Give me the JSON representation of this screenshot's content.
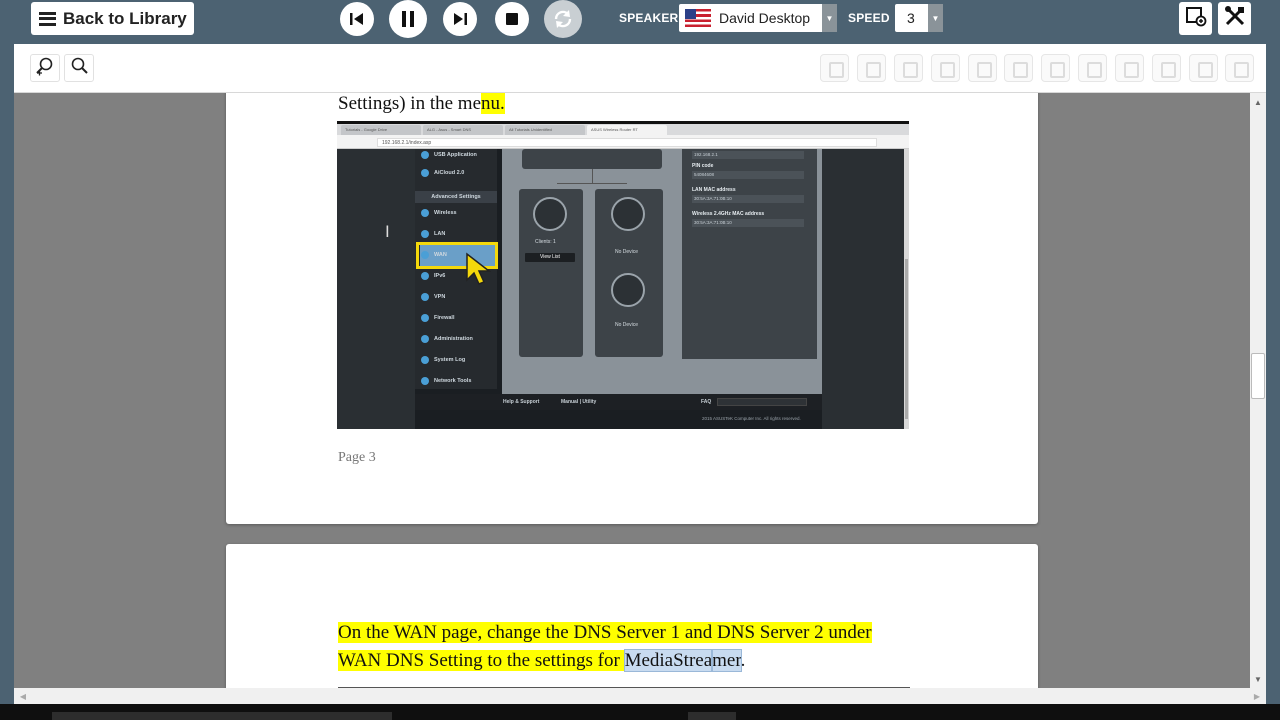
{
  "toolbar": {
    "back_label": "Back to Library",
    "speaker_label": "SPEAKER",
    "speaker_value": "David Desktop",
    "speed_label": "SPEED",
    "speed_value": "3"
  },
  "colors": {
    "toolbar_bg": "#4c6272",
    "highlight": "#ffff00",
    "selection": "#c8dbf0",
    "viewport_bg": "#808080"
  },
  "icons": {
    "back": "list-icon",
    "prev": "skip-back-icon",
    "pause": "pause-icon",
    "next": "skip-forward-icon",
    "stop": "stop-icon",
    "repeat": "repeat-icon",
    "right_tool_1": "screen-capture-icon",
    "right_tool_2": "tools-icon",
    "zoom_in": "zoom-in-icon",
    "zoom_out": "zoom-out-icon"
  },
  "document": {
    "page3": {
      "top_text_plain": "Settings) in the me",
      "top_text_highlight": "nu.",
      "page_number": "Page 3"
    },
    "page4": {
      "line1": "On the WAN page, change the DNS Server 1 and DNS Server 2 under",
      "line2_highlight": "WAN DNS Setting to the settings for ",
      "line2_selected_hl": "MediaStrea",
      "line2_selected_plain": "mer",
      "line2_end": "."
    }
  },
  "screenshot": {
    "tabs": [
      "Tutorials - Google Drive",
      "ALG - Asus - Smart DNS",
      "All Tutorials Unidentified",
      "ASUS Wireless Router RT"
    ],
    "url": "192.168.2.1/index.asp",
    "menu_items": [
      "USB Application",
      "AiCloud 2.0",
      "Wireless",
      "LAN",
      "WAN",
      "IPv6",
      "VPN",
      "Firewall",
      "Administration",
      "System Log",
      "Network Tools"
    ],
    "section_header": "Advanced Settings",
    "clients_text": "Clients: 1",
    "view_list": "View List",
    "no_device_1": "No Device",
    "no_device_2": "No Device",
    "right_panel": [
      {
        "label": "",
        "value": "192.168.2.1"
      },
      {
        "label": "PIN code",
        "value": "54084608"
      },
      {
        "label": "LAN MAC address",
        "value": "30:5A:3A:71:0B:10"
      },
      {
        "label": "Wireless 2.4GHz MAC address",
        "value": "30:5A:3A:71:0B:10"
      }
    ],
    "footer_help": "Help & Support",
    "footer_manual": "Manual | Utility",
    "footer_faq": "FAQ",
    "copyright": "2015 ASUSTeK Computer Inc. All rights reserved."
  }
}
